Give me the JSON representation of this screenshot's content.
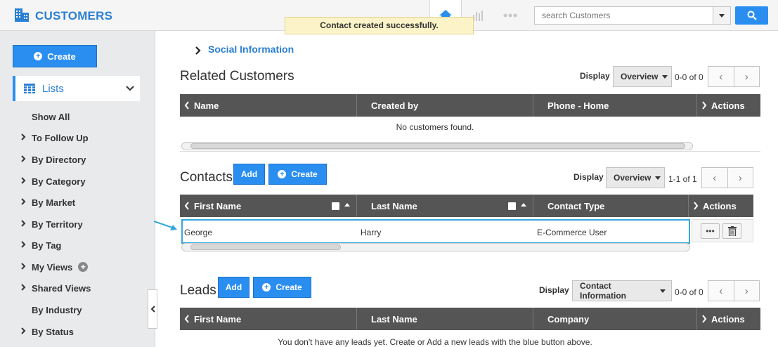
{
  "app": {
    "title": "CUSTOMERS"
  },
  "search": {
    "placeholder": "search Customers"
  },
  "toast": "Contact created successfully.",
  "sidebar": {
    "create_label": "Create",
    "lists_label": "Lists",
    "items": [
      {
        "label": "Show All",
        "chevron": false
      },
      {
        "label": "To Follow Up",
        "chevron": true
      },
      {
        "label": "By Directory",
        "chevron": true
      },
      {
        "label": "By Category",
        "chevron": true
      },
      {
        "label": "By Market",
        "chevron": true
      },
      {
        "label": "By Territory",
        "chevron": true
      },
      {
        "label": "By Tag",
        "chevron": true
      },
      {
        "label": "My Views",
        "chevron": true
      },
      {
        "label": "Shared Views",
        "chevron": true
      },
      {
        "label": "By Industry",
        "chevron": false
      },
      {
        "label": "By Status",
        "chevron": true
      }
    ]
  },
  "social": {
    "label": "Social Information"
  },
  "related": {
    "title": "Related Customers",
    "display_label": "Display",
    "display_value": "Overview",
    "count": "0-0 of 0",
    "columns": [
      "Name",
      "Created by",
      "Phone - Home",
      "Actions"
    ],
    "empty": "No customers found."
  },
  "contacts": {
    "title": "Contacts",
    "add_label": "Add",
    "create_label": "Create",
    "display_label": "Display",
    "display_value": "Overview",
    "count": "1-1 of 1",
    "columns": [
      "First Name",
      "Last Name",
      "Contact Type",
      "Actions"
    ],
    "rows": [
      {
        "first_name": "George",
        "last_name": "Harry",
        "contact_type": "E-Commerce User"
      }
    ]
  },
  "leads": {
    "title": "Leads",
    "add_label": "Add",
    "create_label": "Create",
    "display_label": "Display",
    "display_value": "Contact Information",
    "count": "0-0 of 0",
    "columns": [
      "First Name",
      "Last Name",
      "Company",
      "Actions"
    ],
    "empty": "You don't have any leads yet. Create or Add a new leads with the blue button above."
  }
}
